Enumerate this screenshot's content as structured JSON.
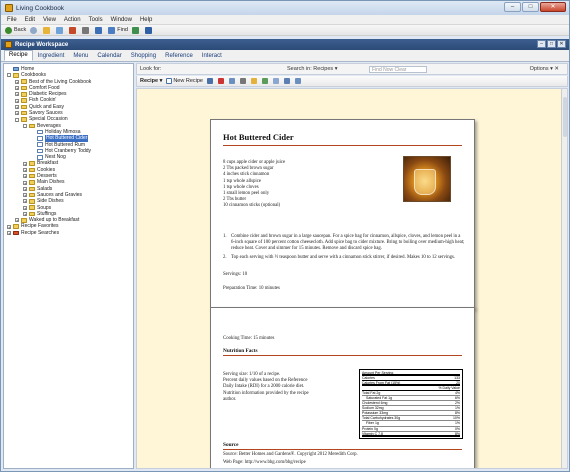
{
  "window": {
    "title": "Living Cookbook",
    "controls": [
      "–",
      "□",
      "✕"
    ]
  },
  "menubar": [
    "File",
    "Edit",
    "View",
    "Action",
    "Tools",
    "Window",
    "Help"
  ],
  "toolbar": {
    "back": "Back",
    "find": "Find"
  },
  "workspace": {
    "title": "Recipe Workspace"
  },
  "tabs": [
    "Recipe",
    "Ingredient",
    "Menu",
    "Calendar",
    "Shopping",
    "Reference",
    "Interact"
  ],
  "tree": [
    {
      "label": "Home",
      "depth": 0,
      "icon": "home"
    },
    {
      "label": "Cookbooks",
      "depth": 0,
      "icon": "folder",
      "exp": "-"
    },
    {
      "label": "Best of the Living Cookbook",
      "depth": 1,
      "icon": "folder",
      "exp": "+"
    },
    {
      "label": "Comfort Food",
      "depth": 1,
      "icon": "folder",
      "exp": "+"
    },
    {
      "label": "Diabetic Recipes",
      "depth": 1,
      "icon": "folder",
      "exp": "+"
    },
    {
      "label": "Fish Cookin'",
      "depth": 1,
      "icon": "folder",
      "exp": "+"
    },
    {
      "label": "Quick and Easy",
      "depth": 1,
      "icon": "folder",
      "exp": "+"
    },
    {
      "label": "Savory Sauces",
      "depth": 1,
      "icon": "folder",
      "exp": "+"
    },
    {
      "label": "Special Occasion",
      "depth": 1,
      "icon": "folder",
      "exp": "-"
    },
    {
      "label": "Beverages",
      "depth": 2,
      "icon": "folder",
      "exp": "-"
    },
    {
      "label": "Holiday Mimosa",
      "depth": 3,
      "icon": "doc"
    },
    {
      "label": "Hot Buttered Cider",
      "depth": 3,
      "icon": "doc",
      "selected": true
    },
    {
      "label": "Hot Buttered Rum",
      "depth": 3,
      "icon": "doc"
    },
    {
      "label": "Hot Cranberry Toddy",
      "depth": 3,
      "icon": "doc"
    },
    {
      "label": "Nest Nog",
      "depth": 3,
      "icon": "doc"
    },
    {
      "label": "Breakfast",
      "depth": 2,
      "icon": "folder",
      "exp": "+"
    },
    {
      "label": "Cookies",
      "depth": 2,
      "icon": "folder",
      "exp": "+"
    },
    {
      "label": "Desserts",
      "depth": 2,
      "icon": "folder",
      "exp": "+"
    },
    {
      "label": "Main Dishes",
      "depth": 2,
      "icon": "folder",
      "exp": "+"
    },
    {
      "label": "Salads",
      "depth": 2,
      "icon": "folder",
      "exp": "+"
    },
    {
      "label": "Sauces and Gravies",
      "depth": 2,
      "icon": "folder",
      "exp": "+"
    },
    {
      "label": "Side Dishes",
      "depth": 2,
      "icon": "folder",
      "exp": "+"
    },
    {
      "label": "Soups",
      "depth": 2,
      "icon": "folder",
      "exp": "+"
    },
    {
      "label": "Stuffings",
      "depth": 2,
      "icon": "folder",
      "exp": "+"
    },
    {
      "label": "Waked up to Breakfast",
      "depth": 1,
      "icon": "folder",
      "exp": "+"
    },
    {
      "label": "Recipe Favorites",
      "depth": 0,
      "icon": "folder",
      "exp": "+"
    },
    {
      "label": "Recipe Searches",
      "depth": 0,
      "icon": "star",
      "exp": "+"
    }
  ],
  "lookbar": {
    "look_for": "Look for:",
    "search_in": "Search in:  Recipes ▾",
    "filter_placeholder": "Find Now   Clear",
    "options": "Options ▾  ✕"
  },
  "recipe_toolbar": {
    "recipe_menu": "Recipe ▾",
    "new_recipe": "New Recipe"
  },
  "recipe": {
    "title": "Hot Buttered Cider",
    "ingredients": [
      "8 cups apple cider or apple juice",
      "2 Tbs packed brown sugar",
      "4 inches stick cinnamon",
      "1 tsp whole allspice",
      "1 tsp whole cloves",
      "1 small lemon peel only",
      "2 Tbs butter",
      "10 cinnamon sticks (optional)"
    ],
    "directions": [
      {
        "num": "1.",
        "text": "Combine cider and brown sugar in a large saucepan. For a spice bag for cinnamon, allspice, cloves, and lemon peel in a 6-inch square of 100 percent cotton cheesecloth. Add spice bag to cider mixture. Bring to boiling over medium-high heat; reduce heat. Cover and simmer for 15 minutes. Remove and discard spice bag."
      },
      {
        "num": "2.",
        "text": "Top each serving with ½ teaspoon butter and serve with a cinnamon stick stirrer, if desired. Makes 10 to 12 servings."
      }
    ],
    "servings": "Servings: 10",
    "prep_time": "Preparation Time: 10 minutes",
    "cook_time": "Cooking Time: 15 minutes",
    "nutrition_head": "Nutrition Facts",
    "nutrition_desc": [
      "Serving size: 1/10 of a recipe.",
      "Percent daily values based on the Reference",
      "Daily Intake (RDI) for a 2000 calorie diet.",
      "Nutrition information provided by the recipe",
      "author."
    ],
    "nutrition_rows": [
      {
        "label": "Amount Per Serving",
        "value": "",
        "style": "thick"
      },
      {
        "label": "Calories",
        "value": "133",
        "style": "mid"
      },
      {
        "label": "Calories From Fat (15%)",
        "value": "20",
        "style": "thick"
      },
      {
        "label": "",
        "value": "% Daily Value",
        "style": "mid"
      },
      {
        "label": "Total Fat 2g",
        "value": "4%",
        "style": ""
      },
      {
        "label": "Saturated Fat 1g",
        "value": "6%",
        "style": "indent"
      },
      {
        "label": "Cholesterol 6mg",
        "value": "2%",
        "style": ""
      },
      {
        "label": "Sodium 32mg",
        "value": "1%",
        "style": ""
      },
      {
        "label": "Potassium 33mg",
        "value": "8%",
        "style": ""
      },
      {
        "label": "Total Carbohydrates 30g",
        "value": "10%",
        "style": ""
      },
      {
        "label": "Fiber 1g",
        "value": "1%",
        "style": "indent"
      },
      {
        "label": "Protein 0g",
        "value": "0%",
        "style": ""
      },
      {
        "label": "Vitamin C 7.8",
        "value": "8%",
        "style": "thick"
      }
    ],
    "source_head": "Source",
    "source": "Source: Better Homes and Gardens®. Copyright 2012 Meredith Corp.",
    "web_page": "Web Page: http://www.bhg.com/bhg/recipe"
  }
}
